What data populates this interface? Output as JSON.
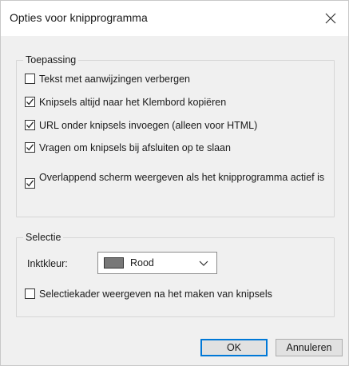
{
  "dialog": {
    "title": "Opties voor knipprogramma",
    "close_icon": "close-icon"
  },
  "application_group": {
    "legend": "Toepassing",
    "options": [
      {
        "label": "Tekst met aanwijzingen verbergen",
        "checked": false
      },
      {
        "label": "Knipsels altijd naar het Klembord kopiëren",
        "checked": true
      },
      {
        "label": "URL onder knipsels invoegen (alleen voor HTML)",
        "checked": true
      },
      {
        "label": "Vragen om knipsels bij afsluiten op te slaan",
        "checked": true
      },
      {
        "label": "Overlappend scherm weergeven als het knipprogramma actief is",
        "checked": true
      }
    ]
  },
  "selection_group": {
    "legend": "Selectie",
    "ink_label": "Inktkleur:",
    "ink_value": "Rood",
    "ink_swatch_color": "#777777",
    "border_option": {
      "label": "Selectiekader weergeven na het maken van knipsels",
      "checked": false
    }
  },
  "buttons": {
    "ok": "OK",
    "cancel": "Annuleren"
  }
}
